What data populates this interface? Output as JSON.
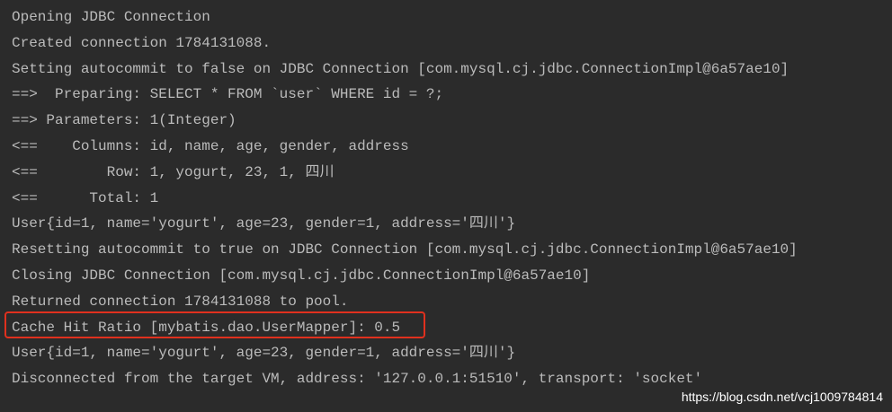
{
  "console": {
    "lines": [
      "Opening JDBC Connection",
      "Created connection 1784131088.",
      "Setting autocommit to false on JDBC Connection [com.mysql.cj.jdbc.ConnectionImpl@6a57ae10]",
      "==>  Preparing: SELECT * FROM `user` WHERE id = ?;",
      "==> Parameters: 1(Integer)",
      "<==    Columns: id, name, age, gender, address",
      "<==        Row: 1, yogurt, 23, 1, 四川",
      "<==      Total: 1",
      "User{id=1, name='yogurt', age=23, gender=1, address='四川'}",
      "Resetting autocommit to true on JDBC Connection [com.mysql.cj.jdbc.ConnectionImpl@6a57ae10]",
      "Closing JDBC Connection [com.mysql.cj.jdbc.ConnectionImpl@6a57ae10]",
      "Returned connection 1784131088 to pool.",
      "Cache Hit Ratio [mybatis.dao.UserMapper]: 0.5",
      "User{id=1, name='yogurt', age=23, gender=1, address='四川'}",
      "Disconnected from the target VM, address: '127.0.0.1:51510', transport: 'socket'"
    ]
  },
  "watermark": "https://blog.csdn.net/vcj1009784814",
  "colors": {
    "background": "#2b2b2b",
    "text": "#bbbbbb",
    "highlight": "#e0301e"
  }
}
